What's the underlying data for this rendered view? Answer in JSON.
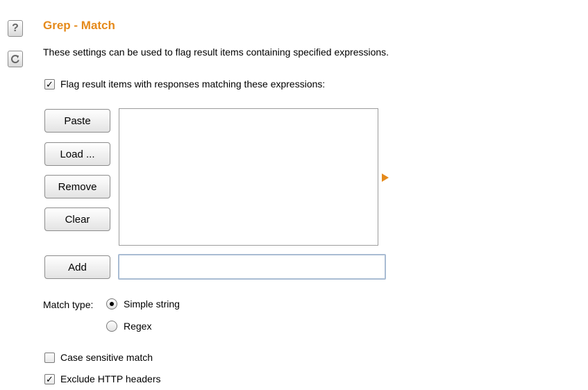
{
  "side_buttons": {
    "help_glyph": "?",
    "help_icon": "question-icon",
    "reset_icon": "refresh-icon"
  },
  "section": {
    "title": "Grep - Match",
    "description": "These settings can be used to flag result items containing specified expressions."
  },
  "flag_checkbox": {
    "label": "Flag result items with responses matching these expressions:",
    "checked": true
  },
  "list_buttons": {
    "paste": "Paste",
    "load": "Load ...",
    "remove": "Remove",
    "clear": "Clear",
    "add": "Add"
  },
  "expression_list": {
    "items": []
  },
  "add_input": {
    "value": ""
  },
  "match_type": {
    "label": "Match type:",
    "options": [
      {
        "label": "Simple string",
        "selected": true
      },
      {
        "label": "Regex",
        "selected": false
      }
    ]
  },
  "options": {
    "case_sensitive": {
      "label": "Case sensitive match",
      "checked": false
    },
    "exclude_headers": {
      "label": "Exclude HTTP headers",
      "checked": true
    }
  },
  "colors": {
    "accent": "#e58a1b",
    "input_border": "#a9bcd3"
  }
}
